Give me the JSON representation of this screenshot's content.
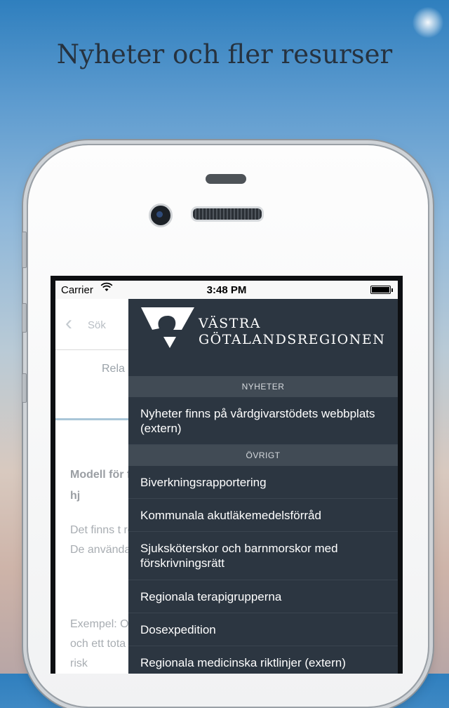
{
  "headline": "Nyheter och fler resurser",
  "status_bar": {
    "carrier": "Carrier",
    "time": "3:48 PM"
  },
  "background_app": {
    "back_label": "Sök",
    "tab_label": "Rela",
    "article_title": "Modell för följd av hj",
    "article_body": "Det finns t rökare. De användas",
    "example_text": "Exempel: Om du rök och ett tota större risk"
  },
  "drawer": {
    "logo": {
      "line1": "VÄSTRA",
      "line2": "GÖTALANDSREGIONEN"
    },
    "sections": [
      {
        "header": "NYHETER",
        "items": [
          "Nyheter finns på vårdgivarstödets webbplats (extern)"
        ]
      },
      {
        "header": "ÖVRIGT",
        "items": [
          "Biverkningsrapportering",
          "Kommunala akutläkemedelsförråd",
          "Sjuksköterskor och barnmorskor med förskrivningsrätt",
          "Regionala terapigrupperna",
          "Dosexpedition",
          "Regionala medicinska riktlinjer (extern)"
        ]
      }
    ]
  },
  "colors": {
    "drawer_bg": "#2c3641",
    "section_header_bg": "#414b55",
    "accent_line": "#a9c6d8"
  }
}
